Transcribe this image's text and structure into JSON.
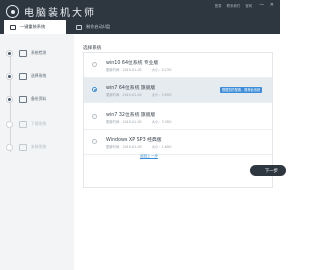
{
  "app": {
    "title": "电脑装机大师",
    "links": [
      "登录",
      "联系我们",
      "官网"
    ],
    "window_controls": [
      "—",
      "✕"
    ]
  },
  "tabs": [
    {
      "label": "一键重装系统",
      "active": true
    },
    {
      "label": "制作启动U盘",
      "active": false
    }
  ],
  "steps": [
    {
      "label": "系统检测",
      "state": "done",
      "icon": "monitor-check-icon"
    },
    {
      "label": "选择系统",
      "state": "done",
      "icon": "monitor-icon"
    },
    {
      "label": "备份资料",
      "state": "done",
      "icon": "backup-icon"
    },
    {
      "label": "下载系统",
      "state": "pending",
      "icon": "download-icon"
    },
    {
      "label": "安装系统",
      "state": "pending",
      "icon": "install-icon"
    }
  ],
  "main": {
    "section_title": "选择系统",
    "systems": [
      {
        "name": "win10 64位系统 专业版",
        "date": "更新时间：2019-01-05",
        "size": "大小：4.23G",
        "selected": false,
        "badge": ""
      },
      {
        "name": "win7 64位系统 旗舰版",
        "date": "更新时间：2019-01-05",
        "size": "大小：3.89G",
        "selected": true,
        "badge": "根据您的配置，推荐此系统"
      },
      {
        "name": "win7 32位系统 旗舰版",
        "date": "更新时间：2019-01-05",
        "size": "大小：3.38G",
        "selected": false,
        "badge": ""
      },
      {
        "name": "Windows XP SP3 经典版",
        "date": "更新时间：2019-01-05",
        "size": "大小：1.69G",
        "selected": false,
        "badge": ""
      }
    ],
    "link_label": "返回上一步",
    "next_label": "下一步"
  },
  "colors": {
    "titlebar": "#2e3640",
    "accent": "#3c8dd9",
    "sidebar": "#f2f4f6"
  }
}
